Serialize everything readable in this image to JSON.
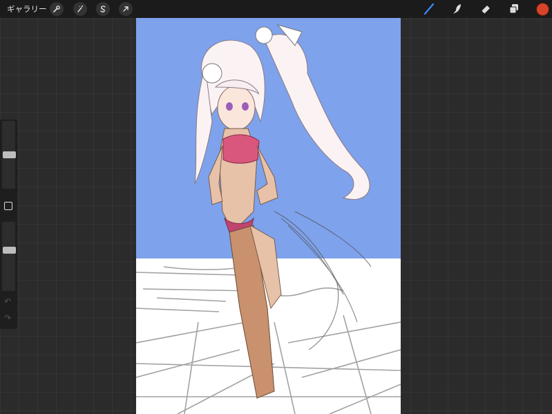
{
  "topbar": {
    "gallery_label": "ギャラリー",
    "left_tools": [
      "wrench-icon",
      "magic-wand-icon",
      "selection-s-icon",
      "transform-arrow-icon"
    ],
    "right_tools": [
      "brush-icon",
      "smudge-icon",
      "eraser-icon",
      "layers-icon"
    ],
    "accent_color": "#3a8cff",
    "current_color": "#d8442a"
  },
  "sidebar": {
    "brush_size_level": 0.5,
    "opacity_level": 0.6
  },
  "canvas": {
    "sky_color": "#7ea2ec",
    "ground_color": "#ffffff"
  }
}
